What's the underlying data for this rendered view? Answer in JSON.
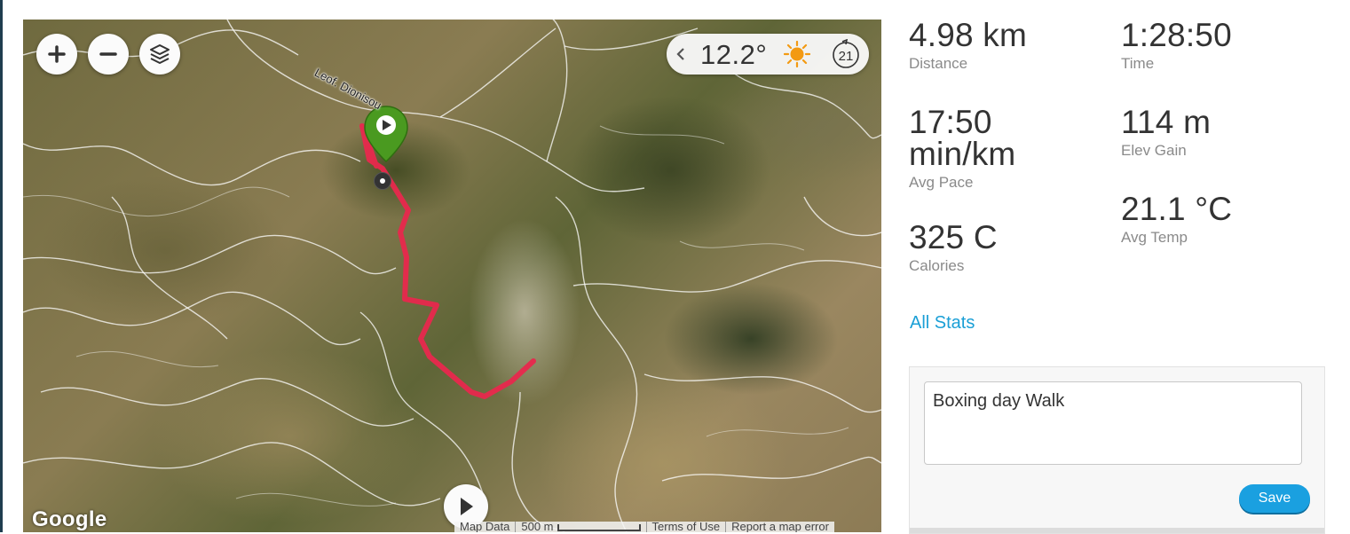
{
  "map": {
    "road_label": "Leof. Dionisou",
    "zoom_in_icon": "plus-icon",
    "zoom_out_icon": "minus-icon",
    "layers_icon": "layers-icon",
    "weather": {
      "temperature": "12.2°",
      "condition_icon": "sun-icon",
      "time_badge": "21"
    },
    "attribution": "Google",
    "footer": {
      "map_data": "Map Data",
      "scale": "500 m",
      "terms": "Terms of Use",
      "report": "Report a map error"
    },
    "route_color": "#e8284d",
    "pin_color": "#4a9a20"
  },
  "stats": {
    "distance": {
      "value": "4.98 km",
      "label": "Distance"
    },
    "time": {
      "value": "1:28:50",
      "label": "Time"
    },
    "pace": {
      "value_line1": "17:50",
      "value_line2": "min/km",
      "label": "Avg Pace"
    },
    "elev_gain": {
      "value": "114 m",
      "label": "Elev Gain"
    },
    "calories": {
      "value": "325 C",
      "label": "Calories"
    },
    "avg_temp": {
      "value": "21.1 °C",
      "label": "Avg Temp"
    }
  },
  "all_stats_link": "All Stats",
  "notes": {
    "text": "Boxing day Walk",
    "save_label": "Save"
  },
  "accent_color": "#1aa0e0"
}
